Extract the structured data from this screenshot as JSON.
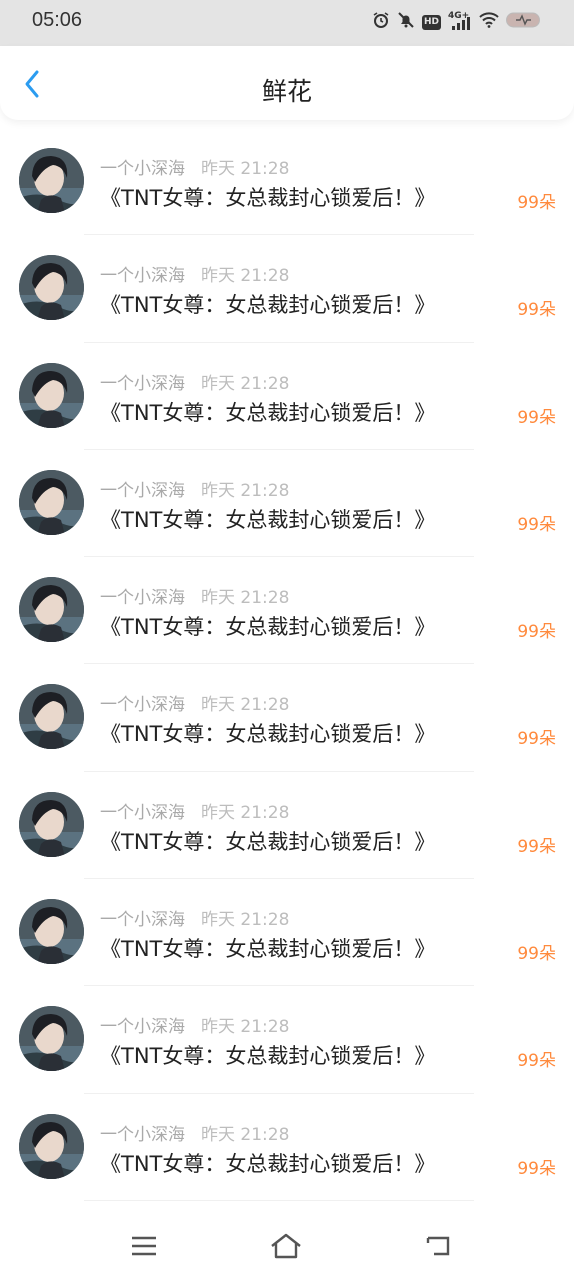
{
  "status_bar": {
    "time": "05:06",
    "icons": [
      "alarm-icon",
      "mute-icon",
      "hd-icon",
      "signal-icon",
      "wifi-icon",
      "battery-icon"
    ],
    "network_label": "4G+",
    "hd_label": "HD"
  },
  "header": {
    "title": "鲜花",
    "back_icon": "chevron-left-icon",
    "accent_color": "#2b9cf0"
  },
  "items": [
    {
      "name": "一个小深海",
      "time": "昨天 21:28",
      "book": "《TNT女尊：女总裁封心锁爱后！》",
      "amount": "99朵"
    },
    {
      "name": "一个小深海",
      "time": "昨天 21:28",
      "book": "《TNT女尊：女总裁封心锁爱后！》",
      "amount": "99朵"
    },
    {
      "name": "一个小深海",
      "time": "昨天 21:28",
      "book": "《TNT女尊：女总裁封心锁爱后！》",
      "amount": "99朵"
    },
    {
      "name": "一个小深海",
      "time": "昨天 21:28",
      "book": "《TNT女尊：女总裁封心锁爱后！》",
      "amount": "99朵"
    },
    {
      "name": "一个小深海",
      "time": "昨天 21:28",
      "book": "《TNT女尊：女总裁封心锁爱后！》",
      "amount": "99朵"
    },
    {
      "name": "一个小深海",
      "time": "昨天 21:28",
      "book": "《TNT女尊：女总裁封心锁爱后！》",
      "amount": "99朵"
    },
    {
      "name": "一个小深海",
      "time": "昨天 21:28",
      "book": "《TNT女尊：女总裁封心锁爱后！》",
      "amount": "99朵"
    },
    {
      "name": "一个小深海",
      "time": "昨天 21:28",
      "book": "《TNT女尊：女总裁封心锁爱后！》",
      "amount": "99朵"
    },
    {
      "name": "一个小深海",
      "time": "昨天 21:28",
      "book": "《TNT女尊：女总裁封心锁爱后！》",
      "amount": "99朵"
    },
    {
      "name": "一个小深海",
      "time": "昨天 21:28",
      "book": "《TNT女尊：女总裁封心锁爱后！》",
      "amount": "99朵"
    }
  ],
  "colors": {
    "amount": "#ff8a3d",
    "meta": "#a9a9a9",
    "status_bg": "#e4e4e4"
  },
  "nav": {
    "icons": [
      "menu-icon",
      "home-icon",
      "back-icon"
    ]
  }
}
